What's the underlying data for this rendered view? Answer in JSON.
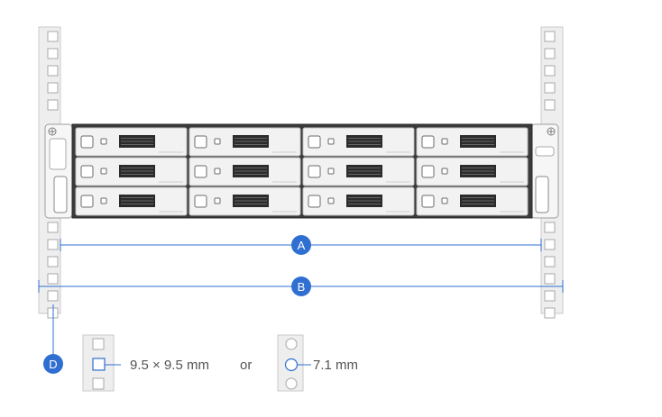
{
  "callouts": {
    "a": "A",
    "b": "B",
    "d": "D"
  },
  "legend": {
    "square_hole_size": "9.5 × 9.5 mm",
    "separator": "or",
    "round_hole_size": "7.1 mm"
  },
  "colors": {
    "accent": "#2f6fd1",
    "rail_fill": "#eeeeee",
    "rail_stroke": "#c9c9c9",
    "hole_stroke": "#a8a8a8",
    "chassis_dark": "#3a3a3a",
    "bay_fill": "#f2f2f2"
  },
  "device": {
    "bay_columns": 4,
    "bay_rows": 3
  }
}
